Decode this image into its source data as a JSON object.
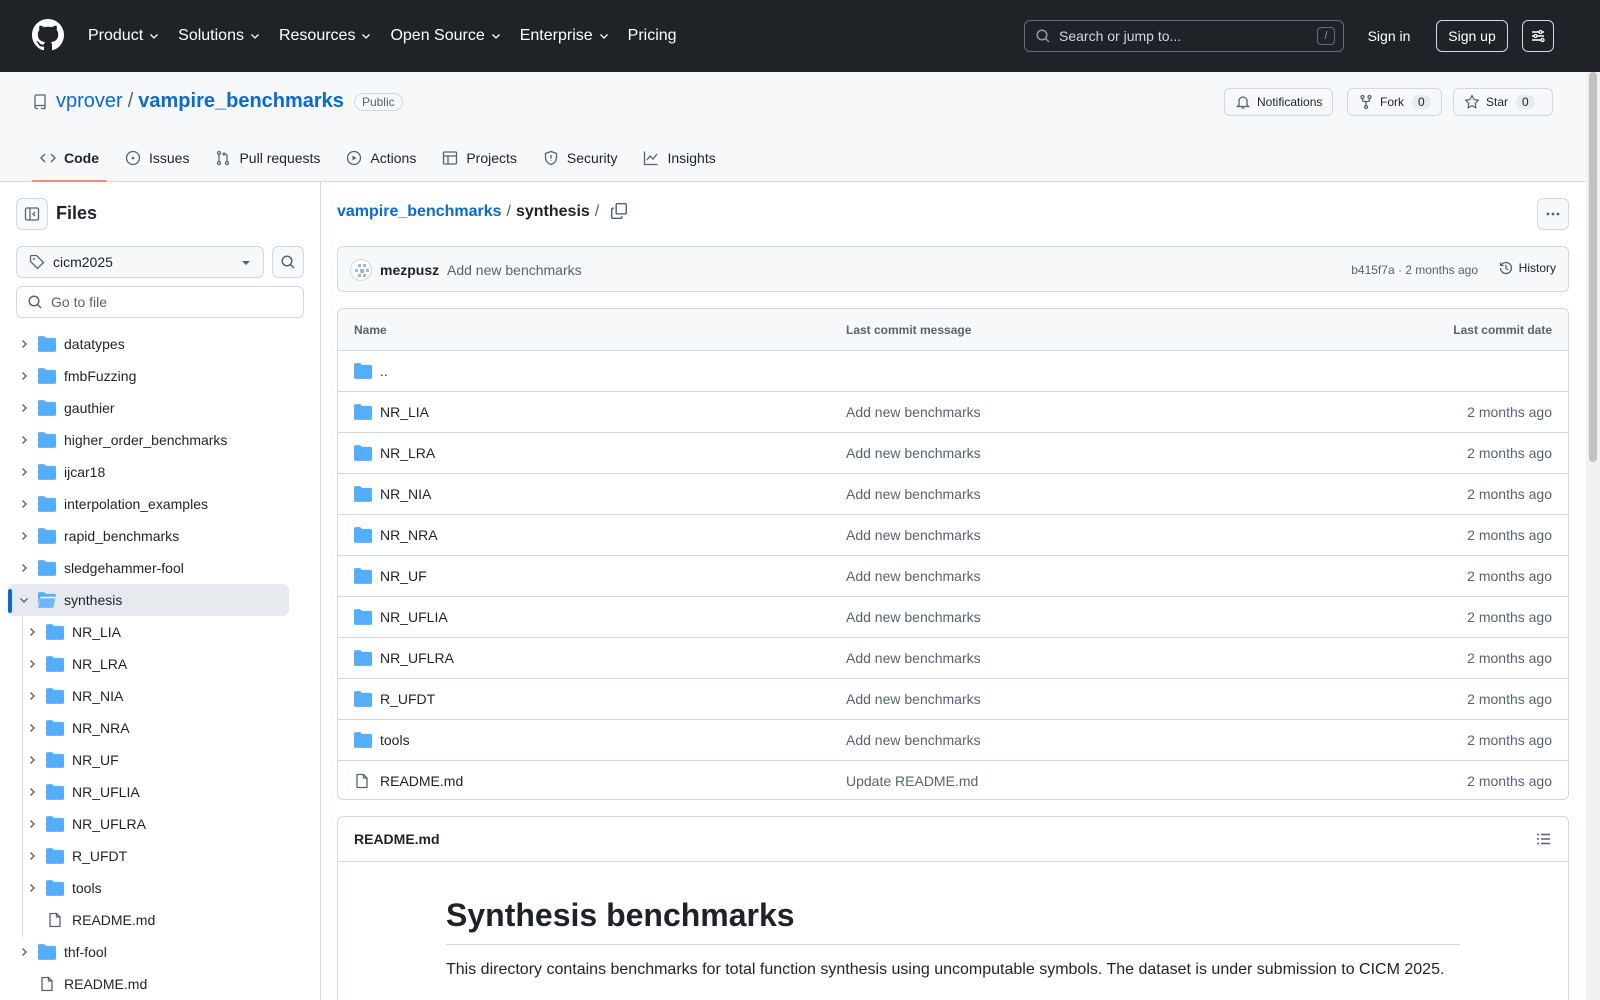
{
  "header": {
    "nav": [
      "Product",
      "Solutions",
      "Resources",
      "Open Source",
      "Enterprise",
      "Pricing"
    ],
    "search_placeholder": "Search or jump to...",
    "search_shortcut": "/",
    "signin": "Sign in",
    "signup": "Sign up"
  },
  "repo": {
    "owner": "vprover",
    "separator": "/",
    "name": "vampire_benchmarks",
    "visibility": "Public",
    "notifications": "Notifications",
    "fork": "Fork",
    "fork_count": "0",
    "star": "Star",
    "star_count": "0",
    "tabs": [
      "Code",
      "Issues",
      "Pull requests",
      "Actions",
      "Projects",
      "Security",
      "Insights"
    ]
  },
  "sidebar": {
    "title": "Files",
    "branch": "cicm2025",
    "goto_placeholder": "Go to file",
    "tree": [
      {
        "label": "datatypes",
        "type": "folder",
        "depth": 0
      },
      {
        "label": "fmbFuzzing",
        "type": "folder",
        "depth": 0
      },
      {
        "label": "gauthier",
        "type": "folder",
        "depth": 0
      },
      {
        "label": "higher_order_benchmarks",
        "type": "folder",
        "depth": 0
      },
      {
        "label": "ijcar18",
        "type": "folder",
        "depth": 0
      },
      {
        "label": "interpolation_examples",
        "type": "folder",
        "depth": 0
      },
      {
        "label": "rapid_benchmarks",
        "type": "folder",
        "depth": 0
      },
      {
        "label": "sledgehammer-fool",
        "type": "folder",
        "depth": 0
      },
      {
        "label": "synthesis",
        "type": "folder-open",
        "depth": 0,
        "selected": true
      },
      {
        "label": "NR_LIA",
        "type": "folder",
        "depth": 1
      },
      {
        "label": "NR_LRA",
        "type": "folder",
        "depth": 1
      },
      {
        "label": "NR_NIA",
        "type": "folder",
        "depth": 1
      },
      {
        "label": "NR_NRA",
        "type": "folder",
        "depth": 1
      },
      {
        "label": "NR_UF",
        "type": "folder",
        "depth": 1
      },
      {
        "label": "NR_UFLIA",
        "type": "folder",
        "depth": 1
      },
      {
        "label": "NR_UFLRA",
        "type": "folder",
        "depth": 1
      },
      {
        "label": "R_UFDT",
        "type": "folder",
        "depth": 1
      },
      {
        "label": "tools",
        "type": "folder",
        "depth": 1
      },
      {
        "label": "README.md",
        "type": "file",
        "depth": 1
      },
      {
        "label": "thf-fool",
        "type": "folder",
        "depth": 0
      },
      {
        "label": "README.md",
        "type": "file",
        "depth": 0
      }
    ]
  },
  "breadcrumb": {
    "root": "vampire_benchmarks",
    "separator": "/",
    "current": "synthesis",
    "trailing": "/"
  },
  "commit": {
    "author": "mezpusz",
    "message": "Add new benchmarks",
    "info": "b415f7a · 2 months ago",
    "history": "History"
  },
  "files": {
    "headers": {
      "name": "Name",
      "message": "Last commit message",
      "date": "Last commit date"
    },
    "rows": [
      {
        "name": "..",
        "type": "folder",
        "message": "",
        "date": ""
      },
      {
        "name": "NR_LIA",
        "type": "folder",
        "message": "Add new benchmarks",
        "date": "2 months ago"
      },
      {
        "name": "NR_LRA",
        "type": "folder",
        "message": "Add new benchmarks",
        "date": "2 months ago"
      },
      {
        "name": "NR_NIA",
        "type": "folder",
        "message": "Add new benchmarks",
        "date": "2 months ago"
      },
      {
        "name": "NR_NRA",
        "type": "folder",
        "message": "Add new benchmarks",
        "date": "2 months ago"
      },
      {
        "name": "NR_UF",
        "type": "folder",
        "message": "Add new benchmarks",
        "date": "2 months ago"
      },
      {
        "name": "NR_UFLIA",
        "type": "folder",
        "message": "Add new benchmarks",
        "date": "2 months ago"
      },
      {
        "name": "NR_UFLRA",
        "type": "folder",
        "message": "Add new benchmarks",
        "date": "2 months ago"
      },
      {
        "name": "R_UFDT",
        "type": "folder",
        "message": "Add new benchmarks",
        "date": "2 months ago"
      },
      {
        "name": "tools",
        "type": "folder",
        "message": "Add new benchmarks",
        "date": "2 months ago"
      },
      {
        "name": "README.md",
        "type": "file",
        "message": "Update README.md",
        "date": "2 months ago"
      }
    ]
  },
  "readme": {
    "file": "README.md",
    "heading": "Synthesis benchmarks",
    "paragraph": "This directory contains benchmarks for total function synthesis using uncomputable symbols. The dataset is under submission to CICM 2025."
  },
  "colors": {
    "header_bg": "#1f2328",
    "link": "#0969da",
    "folder": "#54aeff",
    "tab_underline": "#fd8c73"
  }
}
